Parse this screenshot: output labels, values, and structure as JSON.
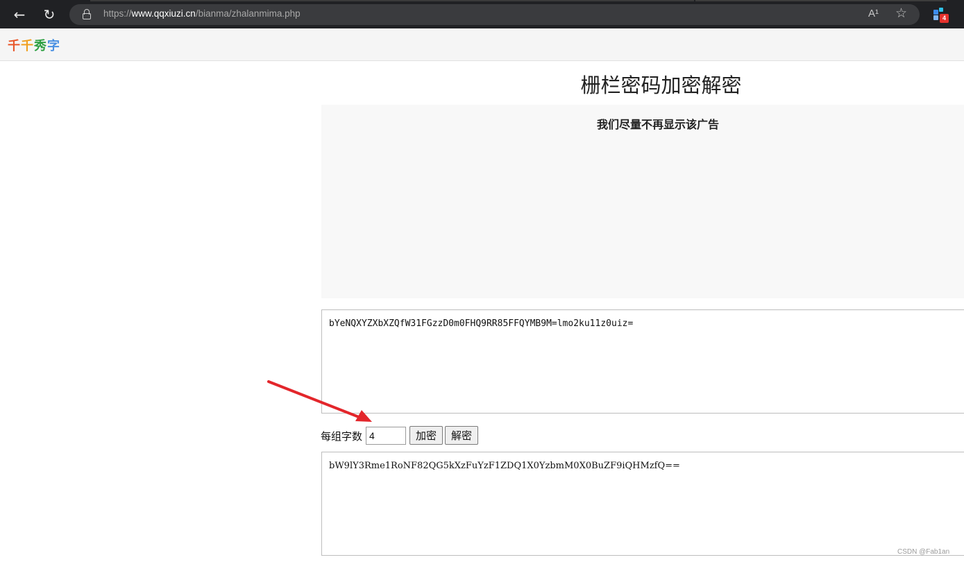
{
  "browser": {
    "url_prefix": "https://",
    "url_host": "www.qqxiuzi.cn",
    "url_path": "/bianma/zhalanmima.php",
    "read_aloud_icon": "A¹",
    "extension_badge": "4",
    "icons": [
      "back-arrow-icon",
      "refresh-icon",
      "lock-icon",
      "read-aloud-icon",
      "favorite-star-icon",
      "extension-icon"
    ]
  },
  "site": {
    "logo_chars": [
      "千",
      "千",
      "秀",
      "字"
    ],
    "logo_colors": [
      "#e8572a",
      "#f0a020",
      "#2ea043",
      "#4a90e2"
    ]
  },
  "main": {
    "title": "栅栏密码加密解密",
    "ad_notice": "我们尽量不再显示该广告",
    "input_text": "bYeNQXYZXbXZQfW31FGzzD0m0FHQ9RR85FFQYMB9M=lmo2ku11z0uiz=",
    "group_label": "每组字数",
    "group_value": "4",
    "encrypt_label": "加密",
    "decrypt_label": "解密",
    "output_text": "bW9lY3Rme1RoNF82QG5kXzFuYzF1ZDQ1X0YzbmM0X0BuZF9iQHMzfQ=="
  },
  "annotation": {
    "arrow_color": "#e3262b"
  },
  "watermark": "CSDN @Fab1an"
}
